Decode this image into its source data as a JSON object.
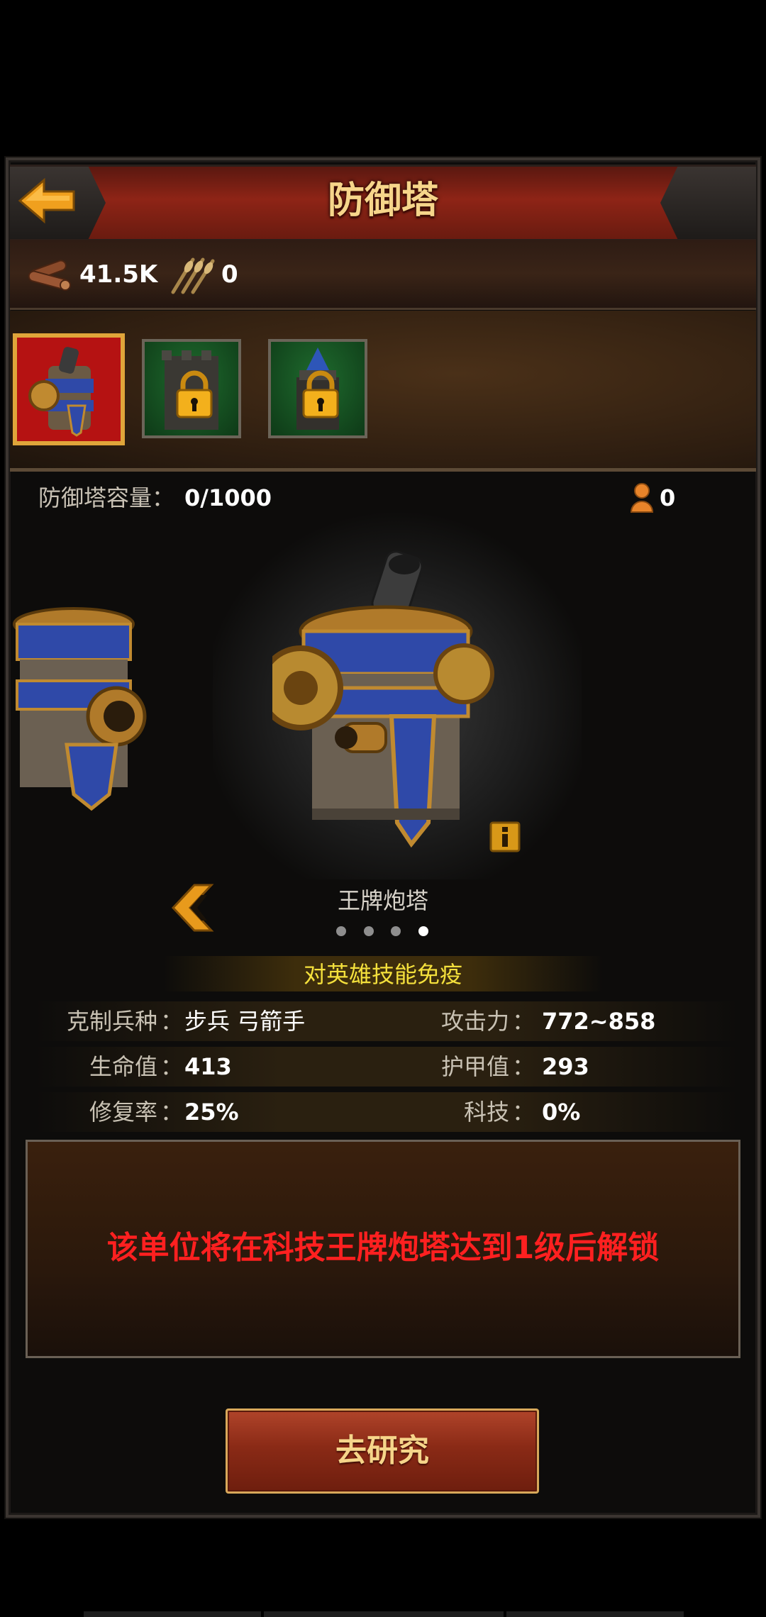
{
  "header": {
    "title": "防御塔",
    "back_icon": "back-arrow-icon"
  },
  "resources": [
    {
      "icon": "wood-icon",
      "value": "41.5K"
    },
    {
      "icon": "wheat-icon",
      "value": "0"
    }
  ],
  "towers": [
    {
      "name": "cannon-tower",
      "state": "selected"
    },
    {
      "name": "stone-tower",
      "state": "locked",
      "icon": "lock-icon"
    },
    {
      "name": "mage-tower",
      "state": "locked",
      "icon": "lock-icon"
    }
  ],
  "capacity": {
    "label": "防御塔容量：",
    "value": "0/1000"
  },
  "hero": {
    "icon": "hero-icon",
    "value": "0"
  },
  "tower_name": "王牌炮塔",
  "pagination": {
    "count": 4,
    "active_index": 3
  },
  "immunity": "对英雄技能免疫",
  "stats": {
    "counter": {
      "label": "克制兵种",
      "value": "步兵 弓箭手"
    },
    "attack": {
      "label": "攻击力",
      "value": "772~858"
    },
    "hp": {
      "label": "生命值",
      "value": "413"
    },
    "armor": {
      "label": "护甲值",
      "value": "293"
    },
    "repair": {
      "label": "修复率",
      "value": "25%"
    },
    "tech": {
      "label": "科技",
      "value": "0%"
    }
  },
  "colon": "：",
  "unlock_message": "该单位将在科技王牌炮塔达到1级后解锁",
  "research_button": "去研究",
  "colors": {
    "accent": "#f6d58a",
    "warning": "#ff2020",
    "immune": "#f4e03c"
  }
}
